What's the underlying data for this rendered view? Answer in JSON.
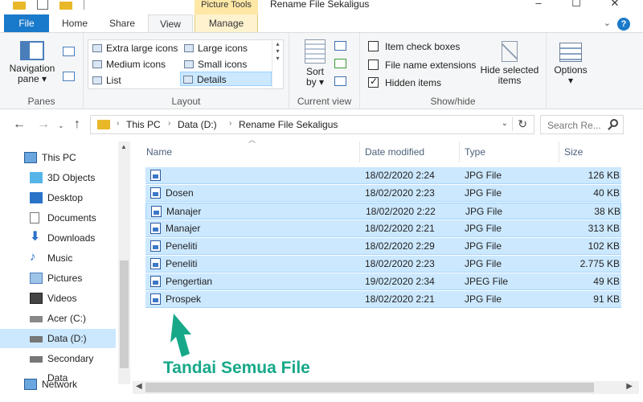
{
  "window": {
    "title": "Rename File Sekaligus",
    "context_tab_group": "Picture Tools",
    "controls": [
      "–",
      "☐",
      "✕"
    ]
  },
  "tabs": [
    {
      "label": "File"
    },
    {
      "label": "Home"
    },
    {
      "label": "Share"
    },
    {
      "label": "View"
    },
    {
      "label": "Manage"
    }
  ],
  "ribbon": {
    "panes": {
      "group_label": "Panes",
      "navigation_pane_line1": "Navigation",
      "navigation_pane_line2": "pane ▾"
    },
    "layout": {
      "group_label": "Layout",
      "items": [
        "Extra large icons",
        "Large icons",
        "Medium icons",
        "Small icons",
        "List",
        "Details"
      ],
      "selected": "Details"
    },
    "current_view": {
      "group_label": "Current view",
      "sort_line1": "Sort",
      "sort_line2": "by ▾"
    },
    "show_hide": {
      "group_label": "Show/hide",
      "checks": [
        {
          "label": "Item check boxes",
          "checked": false
        },
        {
          "label": "File name extensions",
          "checked": false
        },
        {
          "label": "Hidden items",
          "checked": true
        }
      ],
      "hide_selected_line1": "Hide selected",
      "hide_selected_line2": "items"
    },
    "options": {
      "label": "Options",
      "arrow": "▾"
    }
  },
  "address": {
    "crumbs": [
      "This PC",
      "Data  (D:)",
      "Rename File Sekaligus"
    ],
    "separator": "›",
    "search_placeholder": "Search Re..."
  },
  "sidebar": {
    "items": [
      {
        "label": "This PC",
        "icon": "computer-icon"
      },
      {
        "label": "3D Objects",
        "icon": "cube-icon"
      },
      {
        "label": "Desktop",
        "icon": "desktop-icon"
      },
      {
        "label": "Documents",
        "icon": "document-icon"
      },
      {
        "label": "Downloads",
        "icon": "download-icon"
      },
      {
        "label": "Music",
        "icon": "music-icon"
      },
      {
        "label": "Pictures",
        "icon": "pictures-icon"
      },
      {
        "label": "Videos",
        "icon": "video-icon"
      },
      {
        "label": "Acer (C:)",
        "icon": "drive-icon"
      },
      {
        "label": "Data  (D:)",
        "icon": "drive-icon",
        "selected": true
      },
      {
        "label": "Secondary Data",
        "icon": "drive-icon"
      },
      {
        "label": "Network",
        "icon": "network-icon"
      }
    ]
  },
  "file_list": {
    "columns": [
      "Name",
      "Date modified",
      "Type",
      "Size"
    ],
    "rows": [
      {
        "name": "",
        "date": "18/02/2020 2:24",
        "type": "JPG File",
        "size": "126 KB"
      },
      {
        "name": "Dosen",
        "date": "18/02/2020 2:23",
        "type": "JPG File",
        "size": "40 KB"
      },
      {
        "name": "Manajer",
        "date": "18/02/2020 2:22",
        "type": "JPG File",
        "size": "38 KB"
      },
      {
        "name": "Manajer",
        "date": "18/02/2020 2:21",
        "type": "JPG File",
        "size": "313 KB"
      },
      {
        "name": "Peneliti",
        "date": "18/02/2020 2:29",
        "type": "JPG File",
        "size": "102 KB"
      },
      {
        "name": "Peneliti",
        "date": "18/02/2020 2:23",
        "type": "JPG File",
        "size": "2.775 KB"
      },
      {
        "name": "Pengertian",
        "date": "19/02/2020 2:34",
        "type": "JPEG File",
        "size": "49 KB"
      },
      {
        "name": "Prospek",
        "date": "18/02/2020 2:21",
        "type": "JPG File",
        "size": "91 KB"
      }
    ]
  },
  "annotation": {
    "text": "Tandai Semua File",
    "color": "#17a889"
  },
  "colors": {
    "accent": "#1979ca",
    "selection": "#cce8ff",
    "ribbon_bg": "#f5f6f7",
    "picture_tools": "#ffe8a6"
  }
}
